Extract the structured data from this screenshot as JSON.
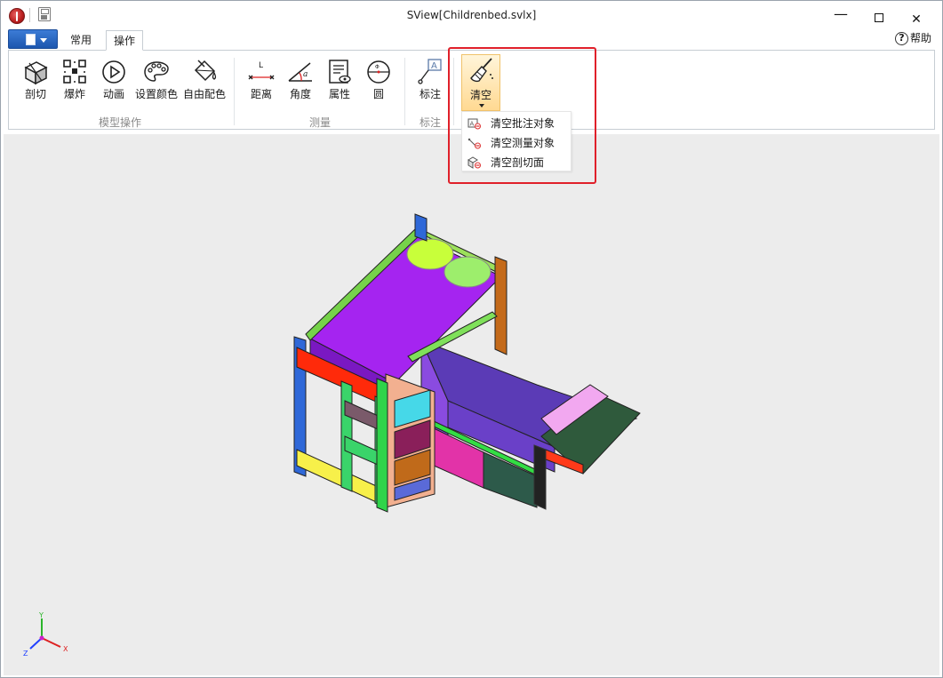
{
  "window": {
    "title": "SView[Childrenbed.svlx]"
  },
  "tabs": [
    {
      "label": "常用"
    },
    {
      "label": "操作"
    }
  ],
  "help": {
    "label": "帮助"
  },
  "ribbon": {
    "groups": {
      "model_ops": "模型操作",
      "measure": "测量",
      "annotate": "标注"
    },
    "buttons": {
      "section": "剖切",
      "explode": "爆炸",
      "animation": "动画",
      "set_color": "设置颜色",
      "free_color": "自由配色",
      "distance": "距离",
      "angle": "角度",
      "property": "属性",
      "circle": "圆",
      "annotation": "标注",
      "clear": "清空"
    }
  },
  "dropdown": {
    "items": [
      {
        "label": "清空批注对象"
      },
      {
        "label": "清空测量对象"
      },
      {
        "label": "清空剖切面"
      }
    ]
  },
  "axis": {
    "x": "X",
    "y": "Y",
    "z": "Z"
  },
  "colors": {
    "accent": "#e0202a",
    "ribbon_border": "#c7cdd3",
    "viewport_bg": "#ececec",
    "clear_btn_bg": "#ffd992"
  }
}
